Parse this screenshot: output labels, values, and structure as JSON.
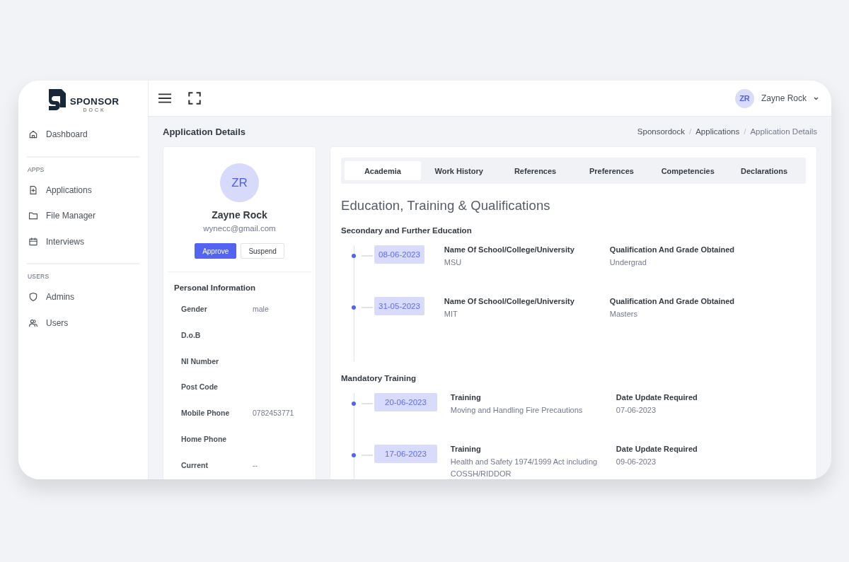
{
  "logo": {
    "name": "SPONSOR",
    "tagline": "DOCK"
  },
  "sidebar": {
    "sections": [
      {
        "items": [
          {
            "label": "Dashboard"
          }
        ]
      },
      {
        "heading": "APPS",
        "items": [
          {
            "label": "Applications"
          },
          {
            "label": "File Manager"
          },
          {
            "label": "Interviews"
          }
        ]
      },
      {
        "heading": "USERS",
        "items": [
          {
            "label": "Admins"
          },
          {
            "label": "Users"
          }
        ]
      }
    ]
  },
  "topbar": {
    "user_initials": "ZR",
    "user_name": "Zayne Rock"
  },
  "page_title": "Application Details",
  "breadcrumb": {
    "separator": "/",
    "items": [
      "Sponsordock",
      "Applications",
      "Application Details"
    ]
  },
  "profile": {
    "initials": "ZR",
    "name": "Zayne Rock",
    "email": "wynecc@gmail.com",
    "buttons": [
      {
        "label": "Approve",
        "kind": "primary"
      },
      {
        "label": "Suspend",
        "kind": "outline"
      }
    ],
    "section_title": "Personal Information",
    "fields": [
      {
        "label": "Gender",
        "value": "male"
      },
      {
        "label": "D.o.B"
      },
      {
        "label": "NI Number"
      },
      {
        "label": "Post Code"
      },
      {
        "label": "Mobile Phone",
        "value": "0782453771"
      },
      {
        "label": "Home Phone"
      },
      {
        "label": "Current",
        "value": "--"
      }
    ]
  },
  "tabs": [
    {
      "label": "Academia",
      "selected": true
    },
    {
      "label": "Work History",
      "selected": false
    },
    {
      "label": "References",
      "selected": false
    },
    {
      "label": "Preferences",
      "selected": false
    },
    {
      "label": "Competencies",
      "selected": false
    },
    {
      "label": "Declarations",
      "selected": false
    }
  ],
  "heading": "Education, Training & Qualifications",
  "groups": [
    {
      "title": "Secondary and Further Education",
      "entries": [
        {
          "date": "08-06-2023",
          "label_1": "Name Of School/College/University",
          "value_1": "MSU",
          "label_2": "Qualification And Grade Obtained",
          "value_2": "Undergrad"
        },
        {
          "date": "31-05-2023",
          "label_1": "Name Of School/College/University",
          "value_1": "MIT",
          "label_2": "Qualification And Grade Obtained",
          "value_2": "Masters"
        }
      ]
    },
    {
      "title": "Mandatory Training",
      "entries": [
        {
          "date": "20-06-2023",
          "label_1": "Training",
          "value_1": "Moving and Handling Fire Precautions",
          "label_2": "Date Update Required",
          "value_2": "07-06-2023"
        },
        {
          "date": "17-06-2023",
          "label_1": "Training",
          "value_1": "Health and Safety 1974/1999 Act including COSSH/RIDDOR",
          "label_2": "Date Update Required",
          "value_2": "09-06-2023"
        }
      ]
    }
  ]
}
